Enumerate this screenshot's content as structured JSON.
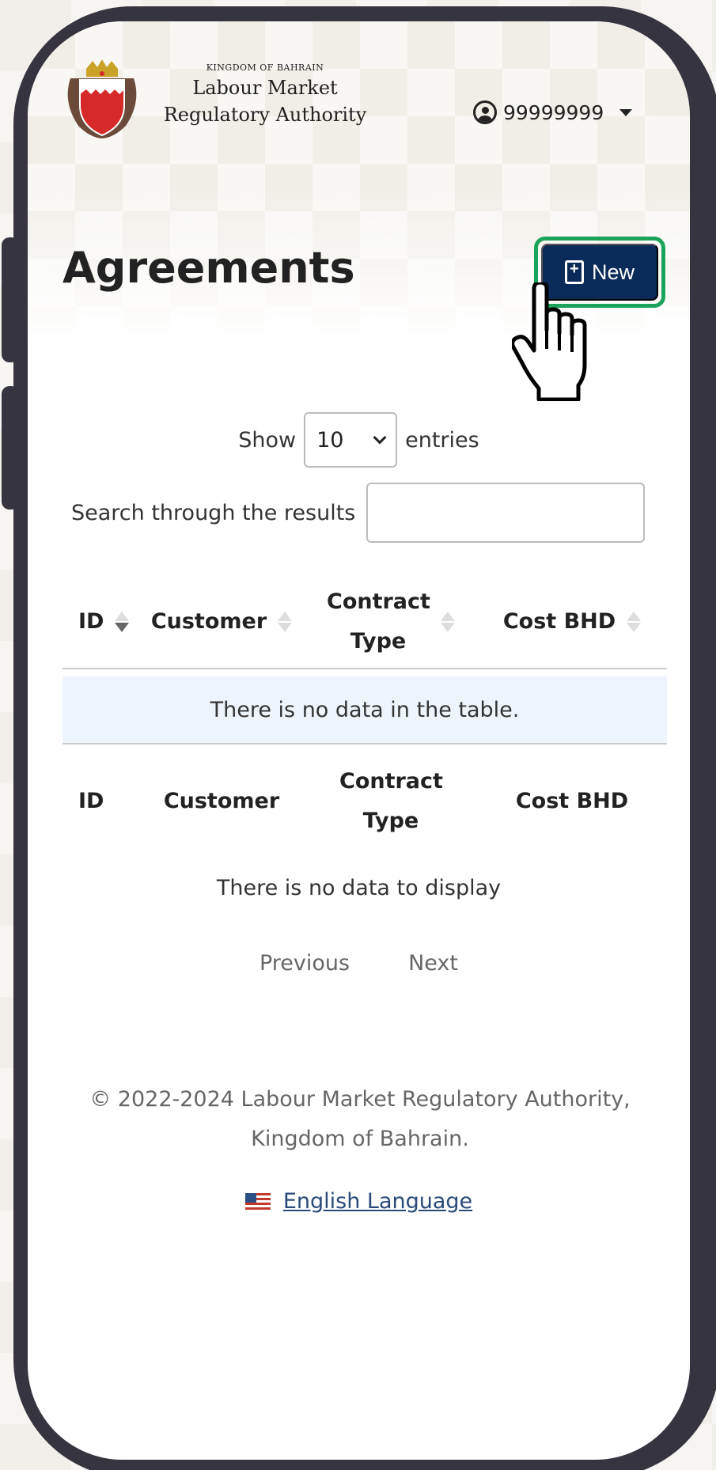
{
  "header": {
    "kingdom": "KINGDOM OF BAHRAIN",
    "org_line1": "Labour Market",
    "org_line2": "Regulatory Authority",
    "user_id": "99999999"
  },
  "page": {
    "title": "Agreements",
    "new_button": "New"
  },
  "table_controls": {
    "show_label": "Show",
    "entries_value": "10",
    "entries_label": "entries",
    "search_label": "Search through the results",
    "search_value": ""
  },
  "table": {
    "columns": [
      "ID",
      "Customer",
      "Contract Type",
      "Cost BHD"
    ],
    "empty_message": "There is no data in the table.",
    "footer_columns": [
      "ID",
      "Customer",
      "Contract Type",
      "Cost BHD"
    ],
    "no_display": "There is no data to display",
    "previous": "Previous",
    "next": "Next"
  },
  "footer": {
    "copyright": "© 2022-2024 Labour Market Regulatory Authority, Kingdom of Bahrain.",
    "language": "English Language"
  },
  "icons": {
    "user": "user-circle-icon",
    "caret": "caret-down-icon",
    "new": "file-plus-icon",
    "cursor": "hand-pointer-icon",
    "flag": "us-flag-icon"
  },
  "colors": {
    "new_button_bg": "#0a2a5a",
    "new_button_highlight": "#1aa35a",
    "frame": "#36343f",
    "empty_row_bg": "#eef4fc"
  }
}
